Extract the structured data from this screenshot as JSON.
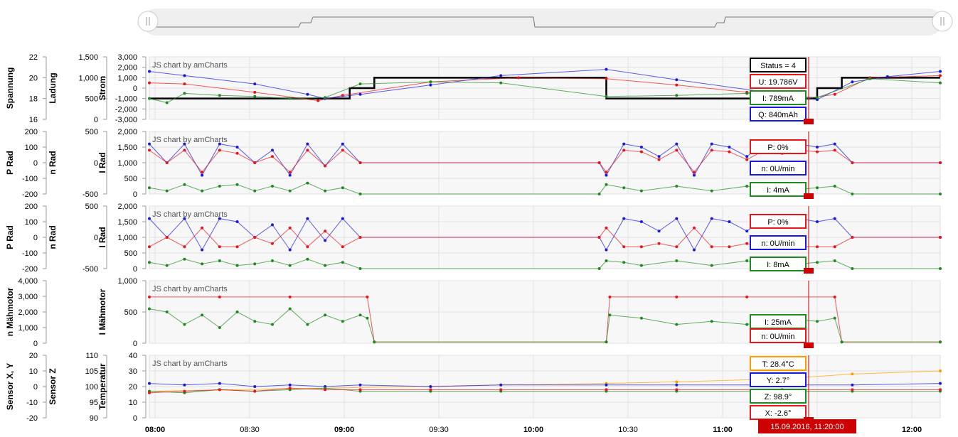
{
  "colors": {
    "red": "#e8151b",
    "blue": "#1a17e0",
    "green": "#1f8a1f",
    "orange": "#ff9e00",
    "black": "#000000",
    "cursor": "#cc0000"
  },
  "x_axis": {
    "tick_labels": [
      "08:00",
      "08:30",
      "09:00",
      "09:30",
      "10:00",
      "10:30",
      "11:00",
      "11:30",
      "12:00"
    ],
    "bold_ticks": [
      "08:00",
      "09:00",
      "10:00",
      "11:00",
      "12:00"
    ]
  },
  "cursor": {
    "label": "15.09.2016, 11:20:00"
  },
  "watermark": "JS chart by amCharts",
  "chart_data": [
    {
      "type": "line",
      "panel": 1,
      "axes": [
        {
          "title": "Spannung",
          "ticks": [
            "22",
            "20",
            "18",
            "16"
          ]
        },
        {
          "title": "Ladung",
          "ticks": [
            "1,500",
            "1,000",
            "500",
            "0"
          ]
        },
        {
          "title": "Strom",
          "ticks": [
            "3,000",
            "2,000",
            "1,000",
            "0",
            "-1,000",
            "-2,000",
            "-3,000"
          ]
        }
      ],
      "y_range": [
        -3000,
        3000
      ],
      "balloons": [
        {
          "text": "Status = 4",
          "color": "#000000"
        },
        {
          "text": "U: 19.786V",
          "color": "#e8151b"
        },
        {
          "text": "I: 789mA",
          "color": "#1f8a1f"
        },
        {
          "text": "Q: 840mAh",
          "color": "#1a17e0"
        }
      ],
      "series": [
        {
          "color": "#000000",
          "kind": "step",
          "x": [
            0,
            0.5,
            0.57,
            0.64,
            1.3,
            1.9,
            1.97,
            2.04,
            2.25
          ],
          "values": [
            -1000,
            -1000,
            0,
            1000,
            -1000,
            0,
            1000,
            1000,
            1000
          ]
        },
        {
          "color": "#e8151b",
          "x": [
            0,
            0.1,
            0.3,
            0.48,
            0.55,
            0.8,
            1.05,
            1.3,
            1.5,
            1.7,
            1.85,
            1.95,
            2.05,
            2.25
          ],
          "values": [
            500,
            400,
            -400,
            -1200,
            -700,
            600,
            1000,
            900,
            300,
            -400,
            -1100,
            -600,
            1000,
            1200
          ]
        },
        {
          "color": "#1a17e0",
          "x": [
            0,
            0.1,
            0.3,
            0.45,
            0.5,
            0.6,
            0.8,
            1.0,
            1.3,
            1.5,
            1.8,
            1.9,
            2.0,
            2.1,
            2.25
          ],
          "values": [
            1600,
            1200,
            400,
            -600,
            -1000,
            -600,
            300,
            1200,
            1800,
            800,
            -600,
            -1100,
            600,
            1100,
            1600
          ]
        },
        {
          "color": "#1f8a1f",
          "x": [
            0,
            0.05,
            0.1,
            0.2,
            0.3,
            0.4,
            0.5,
            0.6,
            0.8,
            1.0,
            1.3,
            1.5,
            1.7,
            1.9,
            2.05,
            2.25
          ],
          "values": [
            -1000,
            -1400,
            -500,
            -700,
            -800,
            -1000,
            -900,
            400,
            600,
            500,
            -800,
            -700,
            -500,
            -900,
            900,
            500
          ]
        }
      ]
    },
    {
      "type": "line",
      "panel": 2,
      "axes": [
        {
          "title": "P Rad",
          "ticks": [
            "200",
            "100",
            "0",
            "-100",
            "-200"
          ]
        },
        {
          "title": "n Rad",
          "ticks": [
            "500",
            "0",
            "-500"
          ]
        },
        {
          "title": "I Rad",
          "ticks": [
            "2,000",
            "1,500",
            "1,000",
            "500",
            "0"
          ]
        }
      ],
      "y_range": [
        0,
        2000
      ],
      "balloons": [
        {
          "text": "P: 0%",
          "color": "#e8151b"
        },
        {
          "text": "n: 0U/min",
          "color": "#1a17e0"
        },
        {
          "text": "I: 4mA",
          "color": "#1f8a1f"
        }
      ],
      "series": [
        {
          "color": "#1a17e0",
          "x": [
            0,
            0.05,
            0.1,
            0.15,
            0.2,
            0.25,
            0.3,
            0.35,
            0.4,
            0.45,
            0.5,
            0.55,
            0.6,
            1.28,
            1.3,
            1.35,
            1.4,
            1.45,
            1.5,
            1.55,
            1.6,
            1.65,
            1.7,
            1.75,
            1.8,
            1.85,
            1.9,
            1.95,
            2.0,
            2.25
          ],
          "values": [
            1600,
            1000,
            1600,
            600,
            1600,
            1500,
            1000,
            1400,
            600,
            1600,
            900,
            1600,
            1000,
            1000,
            600,
            1600,
            1500,
            1200,
            1600,
            600,
            1600,
            1500,
            1200,
            1600,
            1400,
            1600,
            1500,
            1600,
            1000,
            1000
          ]
        },
        {
          "color": "#e8151b",
          "x": [
            0,
            0.05,
            0.1,
            0.15,
            0.2,
            0.25,
            0.3,
            0.35,
            0.4,
            0.45,
            0.5,
            0.55,
            0.6,
            1.28,
            1.3,
            1.35,
            1.4,
            1.45,
            1.5,
            1.55,
            1.6,
            1.65,
            1.7,
            1.75,
            1.8,
            1.85,
            1.9,
            1.95,
            2.0,
            2.25
          ],
          "values": [
            1400,
            1000,
            1400,
            700,
            1400,
            1300,
            1000,
            1200,
            700,
            1400,
            900,
            1400,
            1000,
            1000,
            700,
            1400,
            1350,
            1100,
            1400,
            700,
            1400,
            1350,
            1100,
            1400,
            1300,
            1400,
            1350,
            1400,
            1000,
            1000
          ]
        },
        {
          "color": "#1f8a1f",
          "x": [
            0,
            0.05,
            0.1,
            0.15,
            0.2,
            0.25,
            0.3,
            0.35,
            0.4,
            0.45,
            0.5,
            0.55,
            0.6,
            1.28,
            1.3,
            1.35,
            1.4,
            1.5,
            1.6,
            1.7,
            1.8,
            1.9,
            1.95,
            2.0,
            2.25
          ],
          "values": [
            200,
            100,
            300,
            100,
            250,
            300,
            100,
            250,
            100,
            350,
            100,
            200,
            0,
            0,
            300,
            200,
            100,
            250,
            100,
            250,
            100,
            200,
            250,
            0,
            0
          ]
        }
      ]
    },
    {
      "type": "line",
      "panel": 3,
      "axes": [
        {
          "title": "P Rad",
          "ticks": [
            "200",
            "100",
            "0",
            "-100",
            "-200"
          ]
        },
        {
          "title": "n Rad",
          "ticks": [
            "500",
            "0",
            "-500"
          ]
        },
        {
          "title": "I Rad",
          "ticks": [
            "2,000",
            "1,500",
            "1,000",
            "500",
            "0"
          ]
        }
      ],
      "y_range": [
        0,
        2000
      ],
      "balloons": [
        {
          "text": "P: 0%",
          "color": "#e8151b"
        },
        {
          "text": "n: 0U/min",
          "color": "#1a17e0"
        },
        {
          "text": "I: 8mA",
          "color": "#1f8a1f"
        }
      ],
      "series": [
        {
          "color": "#1a17e0",
          "x": [
            0,
            0.05,
            0.1,
            0.15,
            0.2,
            0.25,
            0.3,
            0.35,
            0.4,
            0.45,
            0.5,
            0.55,
            0.6,
            1.28,
            1.3,
            1.35,
            1.4,
            1.45,
            1.5,
            1.55,
            1.6,
            1.65,
            1.7,
            1.75,
            1.8,
            1.85,
            1.9,
            1.95,
            2.0,
            2.25
          ],
          "values": [
            1600,
            1000,
            1600,
            600,
            1600,
            1500,
            1000,
            1400,
            600,
            1600,
            900,
            1600,
            1000,
            1000,
            600,
            1600,
            1500,
            1200,
            1600,
            600,
            1600,
            1500,
            1200,
            1600,
            1400,
            1600,
            1500,
            1600,
            1000,
            1000
          ]
        },
        {
          "color": "#e8151b",
          "x": [
            0,
            0.05,
            0.1,
            0.15,
            0.2,
            0.25,
            0.3,
            0.35,
            0.4,
            0.45,
            0.5,
            0.55,
            0.6,
            1.28,
            1.3,
            1.35,
            1.4,
            1.45,
            1.5,
            1.55,
            1.6,
            1.65,
            1.7,
            1.75,
            1.8,
            1.85,
            1.9,
            1.95,
            2.0,
            2.25
          ],
          "values": [
            700,
            1000,
            700,
            1300,
            700,
            700,
            1000,
            800,
            1300,
            700,
            1200,
            700,
            1000,
            1000,
            1300,
            700,
            700,
            800,
            700,
            1300,
            700,
            700,
            800,
            700,
            700,
            700,
            700,
            700,
            1000,
            1000
          ]
        },
        {
          "color": "#1f8a1f",
          "x": [
            0,
            0.05,
            0.1,
            0.15,
            0.2,
            0.25,
            0.3,
            0.35,
            0.4,
            0.45,
            0.5,
            0.55,
            0.6,
            1.28,
            1.3,
            1.35,
            1.4,
            1.5,
            1.6,
            1.7,
            1.8,
            1.9,
            1.95,
            2.0,
            2.25
          ],
          "values": [
            200,
            100,
            300,
            150,
            250,
            100,
            150,
            250,
            100,
            300,
            100,
            200,
            0,
            0,
            250,
            200,
            100,
            250,
            100,
            250,
            100,
            200,
            250,
            0,
            0
          ]
        }
      ]
    },
    {
      "type": "line",
      "panel": 4,
      "axes": [
        {
          "title": "n Mähmotor",
          "ticks": [
            "4,000",
            "3,000",
            "2,000",
            "1,000",
            "0"
          ]
        },
        {
          "title": "",
          "ticks": []
        },
        {
          "title": "I Mähmotor",
          "ticks": [
            "1,000",
            "500",
            "0"
          ]
        }
      ],
      "y_range": [
        0,
        1000
      ],
      "balloons": [
        {
          "text": "I: 25mA",
          "color": "#1f8a1f"
        },
        {
          "text": "n: 0U/min",
          "color": "#e8151b"
        }
      ],
      "series": [
        {
          "color": "#e8151b",
          "x": [
            0,
            0.2,
            0.4,
            0.62,
            0.64,
            1.3,
            1.31,
            1.5,
            1.7,
            1.95,
            1.97,
            2.25
          ],
          "values": [
            740,
            740,
            740,
            740,
            20,
            20,
            740,
            740,
            740,
            740,
            20,
            20
          ]
        },
        {
          "color": "#1f8a1f",
          "x": [
            0,
            0.05,
            0.1,
            0.15,
            0.2,
            0.25,
            0.3,
            0.35,
            0.4,
            0.45,
            0.5,
            0.55,
            0.6,
            0.62,
            0.64,
            1.3,
            1.31,
            1.4,
            1.5,
            1.6,
            1.7,
            1.8,
            1.9,
            1.95,
            1.97,
            2.25
          ],
          "values": [
            550,
            500,
            300,
            450,
            250,
            500,
            350,
            300,
            550,
            300,
            450,
            350,
            450,
            400,
            20,
            20,
            450,
            400,
            300,
            350,
            300,
            400,
            350,
            400,
            20,
            20
          ]
        }
      ]
    },
    {
      "type": "line",
      "panel": 5,
      "axes": [
        {
          "title": "Sensor X, Y",
          "ticks": [
            "20",
            "10",
            "0",
            "-10",
            "-20"
          ]
        },
        {
          "title": "Sensor Z",
          "ticks": [
            "110",
            "105",
            "100",
            "95",
            "90"
          ]
        },
        {
          "title": "Temperatur",
          "ticks": [
            "40",
            "30",
            "20",
            "10",
            "0"
          ]
        }
      ],
      "y_range": [
        0,
        40
      ],
      "balloons": [
        {
          "text": "T: 28.4°C",
          "color": "#ff9e00"
        },
        {
          "text": "Y: 2.7°",
          "color": "#1a17e0"
        },
        {
          "text": "Z: 98.9°",
          "color": "#1f8a1f"
        },
        {
          "text": "X: -2.6°",
          "color": "#e8151b"
        }
      ],
      "series": [
        {
          "color": "#ff9e00",
          "x": [
            0,
            0.5,
            1.0,
            1.3,
            1.5,
            1.8,
            2.0,
            2.25
          ],
          "values": [
            17,
            19,
            21,
            22,
            23,
            25,
            28,
            30
          ]
        },
        {
          "color": "#1a17e0",
          "x": [
            0,
            0.1,
            0.2,
            0.3,
            0.4,
            0.5,
            0.6,
            0.8,
            1.0,
            1.3,
            1.5,
            1.8,
            2.0,
            2.25
          ],
          "values": [
            22,
            21,
            22,
            20,
            21,
            20,
            21,
            20,
            21,
            21,
            21,
            21,
            21,
            22
          ]
        },
        {
          "color": "#1f8a1f",
          "x": [
            0,
            0.1,
            0.2,
            0.3,
            0.4,
            0.5,
            0.6,
            0.8,
            1.0,
            1.3,
            1.5,
            1.8,
            2.0,
            2.25
          ],
          "values": [
            17,
            16,
            18,
            17,
            18,
            19,
            17,
            17,
            17,
            17,
            17,
            17,
            17,
            17
          ]
        },
        {
          "color": "#e8151b",
          "x": [
            0,
            0.1,
            0.2,
            0.3,
            0.4,
            0.5,
            0.6,
            0.8,
            1.0,
            1.3,
            1.5,
            1.8,
            2.0,
            2.25
          ],
          "values": [
            16,
            17,
            18,
            17,
            19,
            18,
            18,
            18,
            18,
            18,
            18,
            18,
            18,
            18
          ]
        }
      ]
    }
  ]
}
